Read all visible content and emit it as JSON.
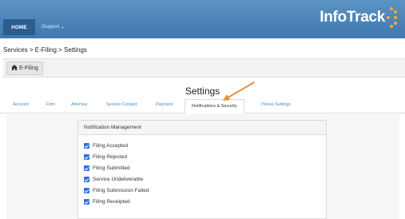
{
  "nav": {
    "home_label": "HOME",
    "support_label": "iSupport",
    "logo_text": "InfoTrack",
    "logo_icon": "infotrack-dots-logo",
    "header_color": "#4a84b9",
    "accent_color": "#f3a93a"
  },
  "breadcrumb": "Services > E-Filing > Settings",
  "section_button": {
    "icon": "home-icon",
    "label": "E-Filing"
  },
  "page_title": "Settings",
  "tabs": [
    {
      "label": "Account"
    },
    {
      "label": "Firm"
    },
    {
      "label": "Attorney"
    },
    {
      "label": "Service Contact"
    },
    {
      "label": "Payment"
    },
    {
      "label": "Notifications & Security",
      "active": true
    },
    {
      "label": "iTexas Settings"
    }
  ],
  "notification_panel": {
    "title": "Notification Management",
    "options": [
      {
        "label": "Filing Accepted",
        "checked": true
      },
      {
        "label": "Filing Rejected",
        "checked": true
      },
      {
        "label": "Filing Submitted",
        "checked": true
      },
      {
        "label": "Service Undeliverable",
        "checked": true
      },
      {
        "label": "Filing Submission Failed",
        "checked": true
      },
      {
        "label": "Filing Receipted",
        "checked": true
      }
    ]
  },
  "annotation": {
    "icon": "pointer-arrow-icon",
    "color": "#e8913a"
  }
}
